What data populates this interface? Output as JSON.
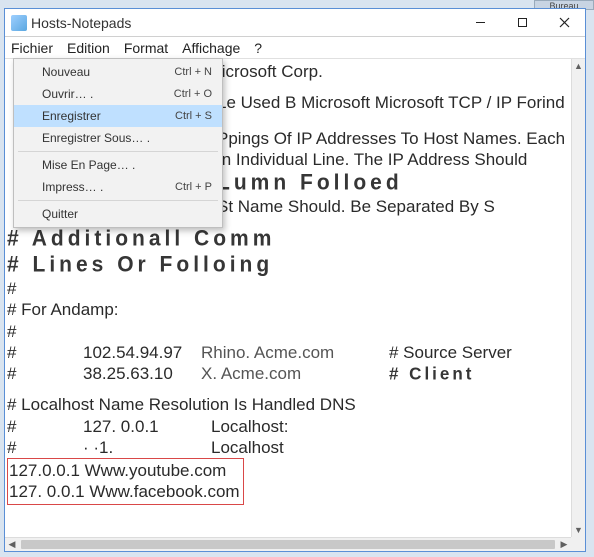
{
  "desktop": {
    "label": "Bureau"
  },
  "window": {
    "title": "Hosts-Notepads",
    "menubar": [
      "Fichier",
      "Edition",
      "Format",
      "Affichage",
      "?"
    ],
    "controls": {
      "min": "minimize",
      "max": "maximize",
      "close": "close"
    }
  },
  "file_menu": {
    "items": [
      {
        "label": "Nouveau",
        "shortcut": "Ctrl + N",
        "sep_after": false,
        "highlight": false
      },
      {
        "label": "Ouvrir… .",
        "shortcut": "Ctrl + O",
        "sep_after": false,
        "highlight": false
      },
      {
        "label": "Enregistrer",
        "shortcut": "Ctrl + S",
        "sep_after": false,
        "highlight": true
      },
      {
        "label": "Enregistrer Sous… .",
        "shortcut": "",
        "sep_after": true,
        "highlight": false
      },
      {
        "label": "Mise En Page… .",
        "shortcut": "",
        "sep_after": false,
        "highlight": false
      },
      {
        "label": "Impress… .",
        "shortcut": "Ctrl + P",
        "sep_after": true,
        "highlight": false
      },
      {
        "label": "Quitter",
        "shortcut": "",
        "sep_after": false,
        "highlight": false
      }
    ]
  },
  "doc": {
    "l1": "Iicrosoft Corp.",
    "l2": "Le Used B Microsoft Microsoft TCP / IP Forind",
    "l3a": "Ppings Of IP Addresses To Host Names. Each",
    "l3b": "In Individual Line. The IP Address Should",
    "big1": "Lumn Folloed",
    "l4": "St Name Should. Be Separated By S",
    "big2": "# Additionall Comm",
    "big3": "# Lines Or Folloing",
    "hash1": "#",
    "forand": "# For Andamp:",
    "hash2": "#",
    "row1_ip": "102.54.94.97",
    "row1_host": "Rhino. Acme.com",
    "row1_note": "# Source Server",
    "row2_ip": "38.25.63.10",
    "row2_host": "X. Acme.com",
    "row2_note": "# Client",
    "local_head": "# Localhost Name Resolution Is Handled DNS",
    "loc1_pre": "#",
    "loc1_ip": "127. 0.0.1",
    "loc1_host": "Localhost:",
    "loc2_pre": "#",
    "loc2_ip": "· ·1.",
    "loc2_host": "Localhost",
    "added1": "127.0.0.1 Www.youtube.com",
    "added2": "127. 0.0.1 Www.facebook.com"
  }
}
